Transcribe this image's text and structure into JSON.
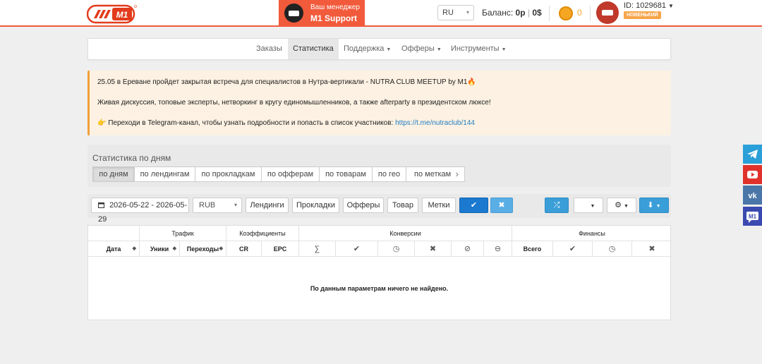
{
  "header": {
    "logo_text": "M1",
    "manager_label": "Ваш менеджер",
    "manager_name": "M1 Support",
    "lang": "RU",
    "balance_label": "Баланс:",
    "balance_rub": "0р",
    "balance_sep": "|",
    "balance_usd": "0$",
    "coins": "0",
    "user_id": "ID: 1029681",
    "user_badge": "НОВЕНЬКИЙ"
  },
  "nav": {
    "items": [
      {
        "label": "Заказы"
      },
      {
        "label": "Статистика",
        "active": true
      },
      {
        "label": "Поддержка"
      },
      {
        "label": "Офферы"
      },
      {
        "label": "Инструменты"
      }
    ]
  },
  "alert": {
    "line1": "25.05 в Ереване пройдет закрытая встреча для специалистов в Нутра-вертикали - NUTRA CLUB MEETUP by M1🔥",
    "line2": "Живая дискуссия, топовые эксперты, нетворкинг в кругу единомышленников, а также afterparty в президентском люксе!",
    "line3": "👉 Переходи в Telegram-канал, чтобы узнать подробности и попасть в список участников: ",
    "link": "https://t.me/nutraclub/144"
  },
  "daystats": {
    "title": "Статистика по дням",
    "tabs": [
      "по дням",
      "по лендингам",
      "по прокладкам",
      "по офферам",
      "по товарам",
      "по гео",
      "по меткам"
    ],
    "more": "›"
  },
  "filters": {
    "date_range": "2026-05-22 - 2026-05-29",
    "currency": "RUB",
    "buttons": [
      "Лендинги",
      "Прокладки",
      "Офферы",
      "Товар",
      "Метки"
    ]
  },
  "table": {
    "groups": [
      "Трафик",
      "Коэффициенты",
      "Конверсии",
      "Финансы"
    ],
    "headers": {
      "date": "Дата",
      "uniq": "Уники",
      "clicks": "Переходы",
      "cr": "CR",
      "epc": "EPC",
      "sum": "∑",
      "total": "Всего"
    },
    "empty": "По данным параметрам ничего не найдено."
  },
  "colors": {
    "brand": "#f15a3b",
    "primary": "#1b79cf",
    "link": "#1f7ec4",
    "alert_border": "#f0a03a"
  }
}
